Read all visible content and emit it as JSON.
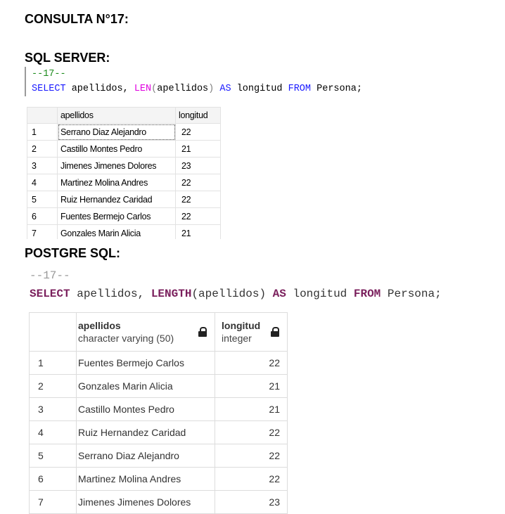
{
  "heading": "CONSULTA N°17:",
  "sqlserver": {
    "title": "SQL SERVER:",
    "comment": "--17--",
    "query": {
      "kw_select": "SELECT",
      "part1": " apellidos, ",
      "fn_len": "LEN",
      "paren_open": "(",
      "part2": "apellidos",
      "paren_close": ")",
      "kw_as": " AS",
      "part3": " longitud ",
      "kw_from": "FROM",
      "part4": " Persona;"
    },
    "columns": [
      "",
      "apellidos",
      "longitud"
    ],
    "rows": [
      [
        "1",
        "Serrano Diaz Alejandro",
        "22"
      ],
      [
        "2",
        "Castillo Montes Pedro",
        "21"
      ],
      [
        "3",
        "Jimenes Jimenes Dolores",
        "23"
      ],
      [
        "4",
        "Martinez Molina Andres",
        "22"
      ],
      [
        "5",
        "Ruiz Hernandez Caridad",
        "22"
      ],
      [
        "6",
        "Fuentes Bermejo Carlos",
        "22"
      ],
      [
        "7",
        "Gonzales Marin Alicia",
        "21"
      ]
    ]
  },
  "postgres": {
    "title": "POSTGRE SQL:",
    "comment": "--17--",
    "query": {
      "kw_select": "SELECT",
      "part1": " apellidos, ",
      "fn_length": "LENGTH",
      "part2": "(apellidos) ",
      "kw_as": "AS",
      "part3": " longitud ",
      "kw_from": "FROM",
      "part4": " Persona;"
    },
    "columns": [
      {
        "name": "apellidos",
        "type": "character varying (50)"
      },
      {
        "name": "longitud",
        "type": "integer"
      }
    ],
    "rows": [
      [
        "1",
        "Fuentes Bermejo Carlos",
        "22"
      ],
      [
        "2",
        "Gonzales Marin Alicia",
        "21"
      ],
      [
        "3",
        "Castillo Montes Pedro",
        "21"
      ],
      [
        "4",
        "Ruiz Hernandez Caridad",
        "22"
      ],
      [
        "5",
        "Serrano Diaz Alejandro",
        "22"
      ],
      [
        "6",
        "Martinez Molina Andres",
        "22"
      ],
      [
        "7",
        "Jimenes Jimenes Dolores",
        "23"
      ]
    ],
    "icons": [
      "lock-icon"
    ]
  }
}
